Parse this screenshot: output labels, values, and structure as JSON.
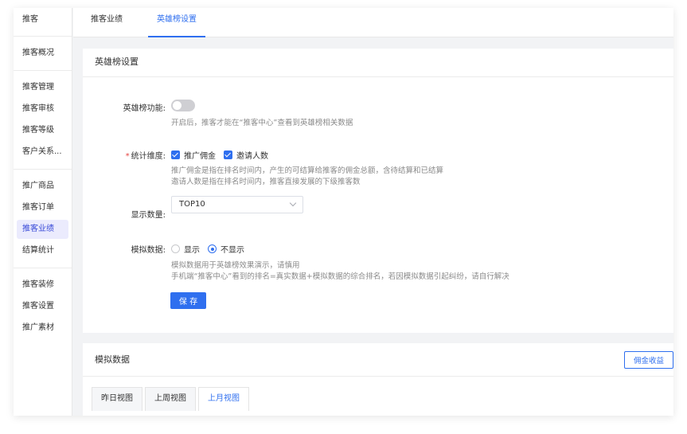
{
  "sidebar": {
    "header": "推客",
    "groups": [
      [
        "推客概况"
      ],
      [
        "推客管理",
        "推客审核",
        "推客等级",
        "客户关系..."
      ],
      [
        "推广商品",
        "推客订单",
        "推客业绩",
        "结算统计"
      ],
      [
        "推客装修",
        "推客设置",
        "推广素材"
      ]
    ],
    "active": "推客业绩"
  },
  "tabs": {
    "performance": "推客业绩",
    "hero": "英雄榜设置"
  },
  "settings": {
    "title": "英雄榜设置",
    "feature_label": "英雄榜功能:",
    "feature_hint": "开启后，推客才能在“推客中心”查看到英雄榜相关数据",
    "feature_enabled": false,
    "dimension_label": "统计维度:",
    "dimension_opt1": "推广佣金",
    "dimension_opt2": "邀请人数",
    "dimension_hint1": "推广佣金是指在排名时间内，产生的可结算给推客的佣金总额，含待结算和已结算",
    "dimension_hint2": "邀请人数是指在排名时间内，推客直接发展的下级推客数",
    "count_label": "显示数量:",
    "count_value": "TOP10",
    "mock_label": "模拟数据:",
    "mock_show": "显示",
    "mock_hide": "不显示",
    "mock_hint1": "模拟数据用于英雄榜效果演示，请慎用",
    "mock_hint2": "手机端“推客中心”看到的排名=真实数据+模拟数据的综合排名，若因模拟数据引起纠纷，请自行解决",
    "save": "保 存"
  },
  "mock": {
    "title": "模拟数据",
    "btn": "佣金收益",
    "tabs": [
      "昨日视图",
      "上周视图",
      "上月视图"
    ],
    "active_tab": "上月视图"
  },
  "colors": {
    "accent": "#2f6fef",
    "sidebar_active_bg": "#ebebfd"
  }
}
